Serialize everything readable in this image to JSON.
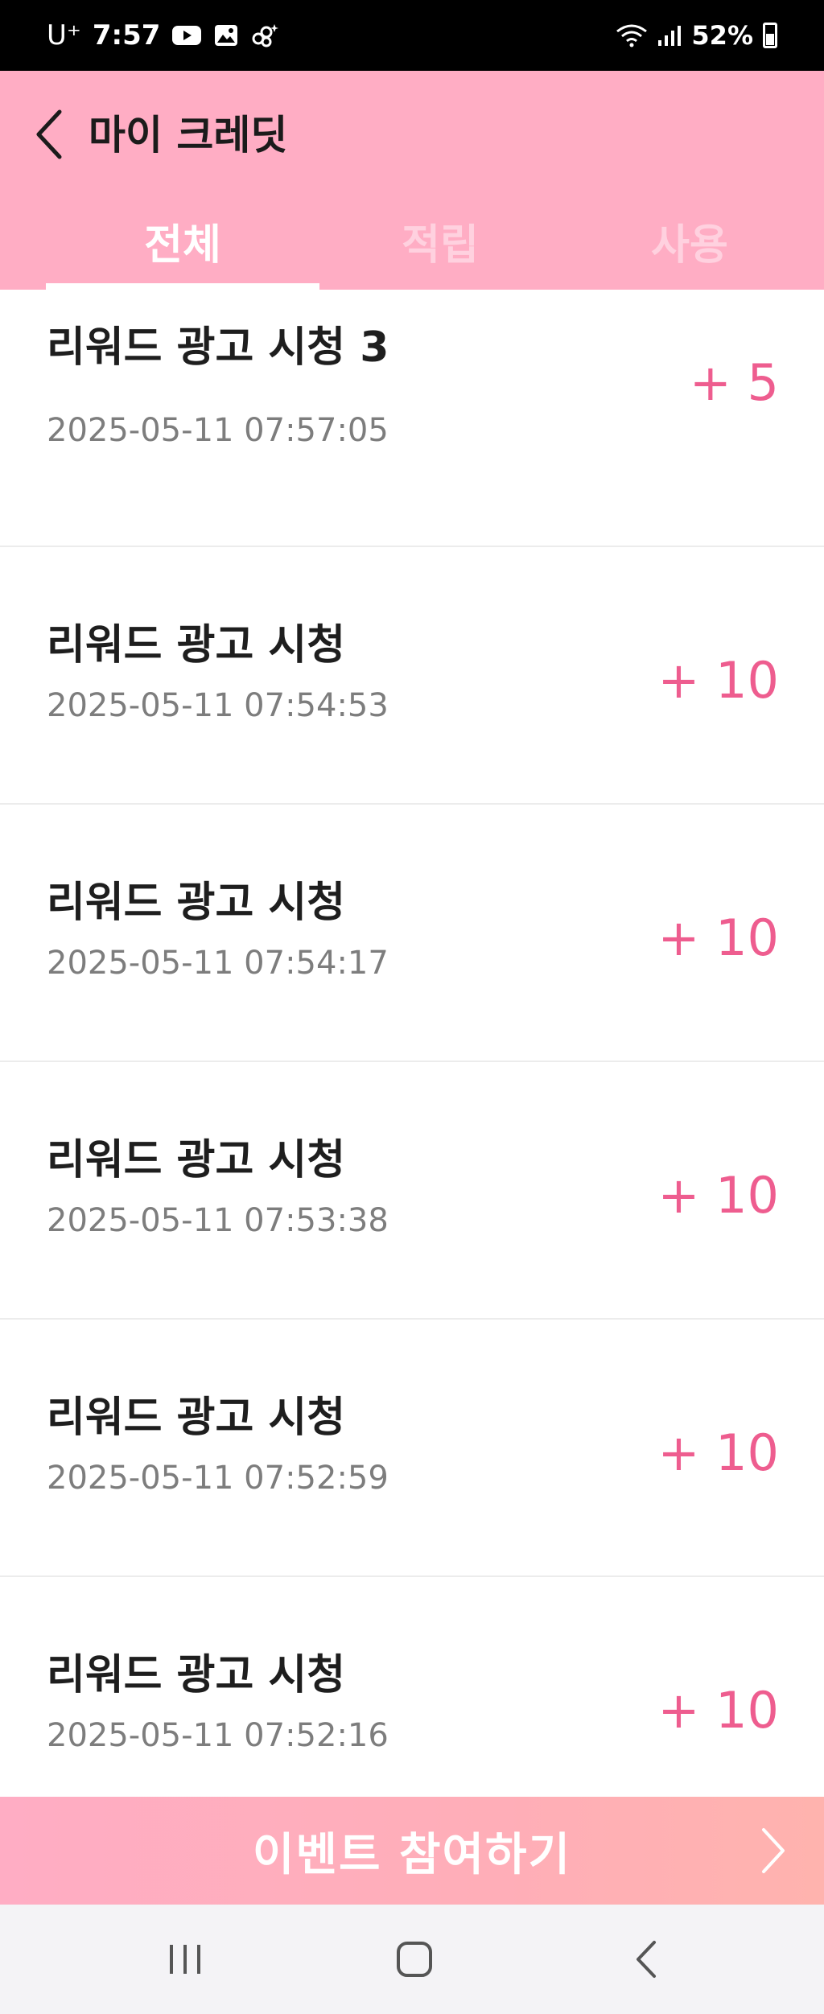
{
  "status_bar": {
    "carrier": "U⁺",
    "time": "7:57",
    "battery": "52%",
    "icons": [
      "youtube-icon",
      "gallery-icon",
      "sparkle-icon",
      "wifi-icon",
      "signal-icon",
      "battery-icon"
    ]
  },
  "header": {
    "title": "마이 크레딧",
    "back_icon": "chevron-left-icon",
    "tabs": [
      {
        "label": "전체",
        "active": true
      },
      {
        "label": "적립",
        "active": false
      },
      {
        "label": "사용",
        "active": false
      }
    ]
  },
  "credits": [
    {
      "title": "리워드 광고 시청 3",
      "date": "2025-05-11 07:57:05",
      "amount": "+ 5"
    },
    {
      "title": "리워드 광고 시청",
      "date": "2025-05-11 07:54:53",
      "amount": "+ 10"
    },
    {
      "title": "리워드 광고 시청",
      "date": "2025-05-11 07:54:17",
      "amount": "+ 10"
    },
    {
      "title": "리워드 광고 시청",
      "date": "2025-05-11 07:53:38",
      "amount": "+ 10"
    },
    {
      "title": "리워드 광고 시청",
      "date": "2025-05-11 07:52:59",
      "amount": "+ 10"
    },
    {
      "title": "리워드 광고 시청",
      "date": "2025-05-11 07:52:16",
      "amount": "+ 10"
    }
  ],
  "event_button": {
    "label": "이벤트 참여하기",
    "icon": "chevron-right-icon"
  },
  "nav_bar": {
    "icons": [
      "recents-icon",
      "home-icon",
      "back-icon"
    ]
  },
  "colors": {
    "header_bg": "#ffadc4",
    "amount": "#ee5d8f",
    "tab_inactive": "#ffd1df",
    "event_bg": "#ffadc4"
  }
}
